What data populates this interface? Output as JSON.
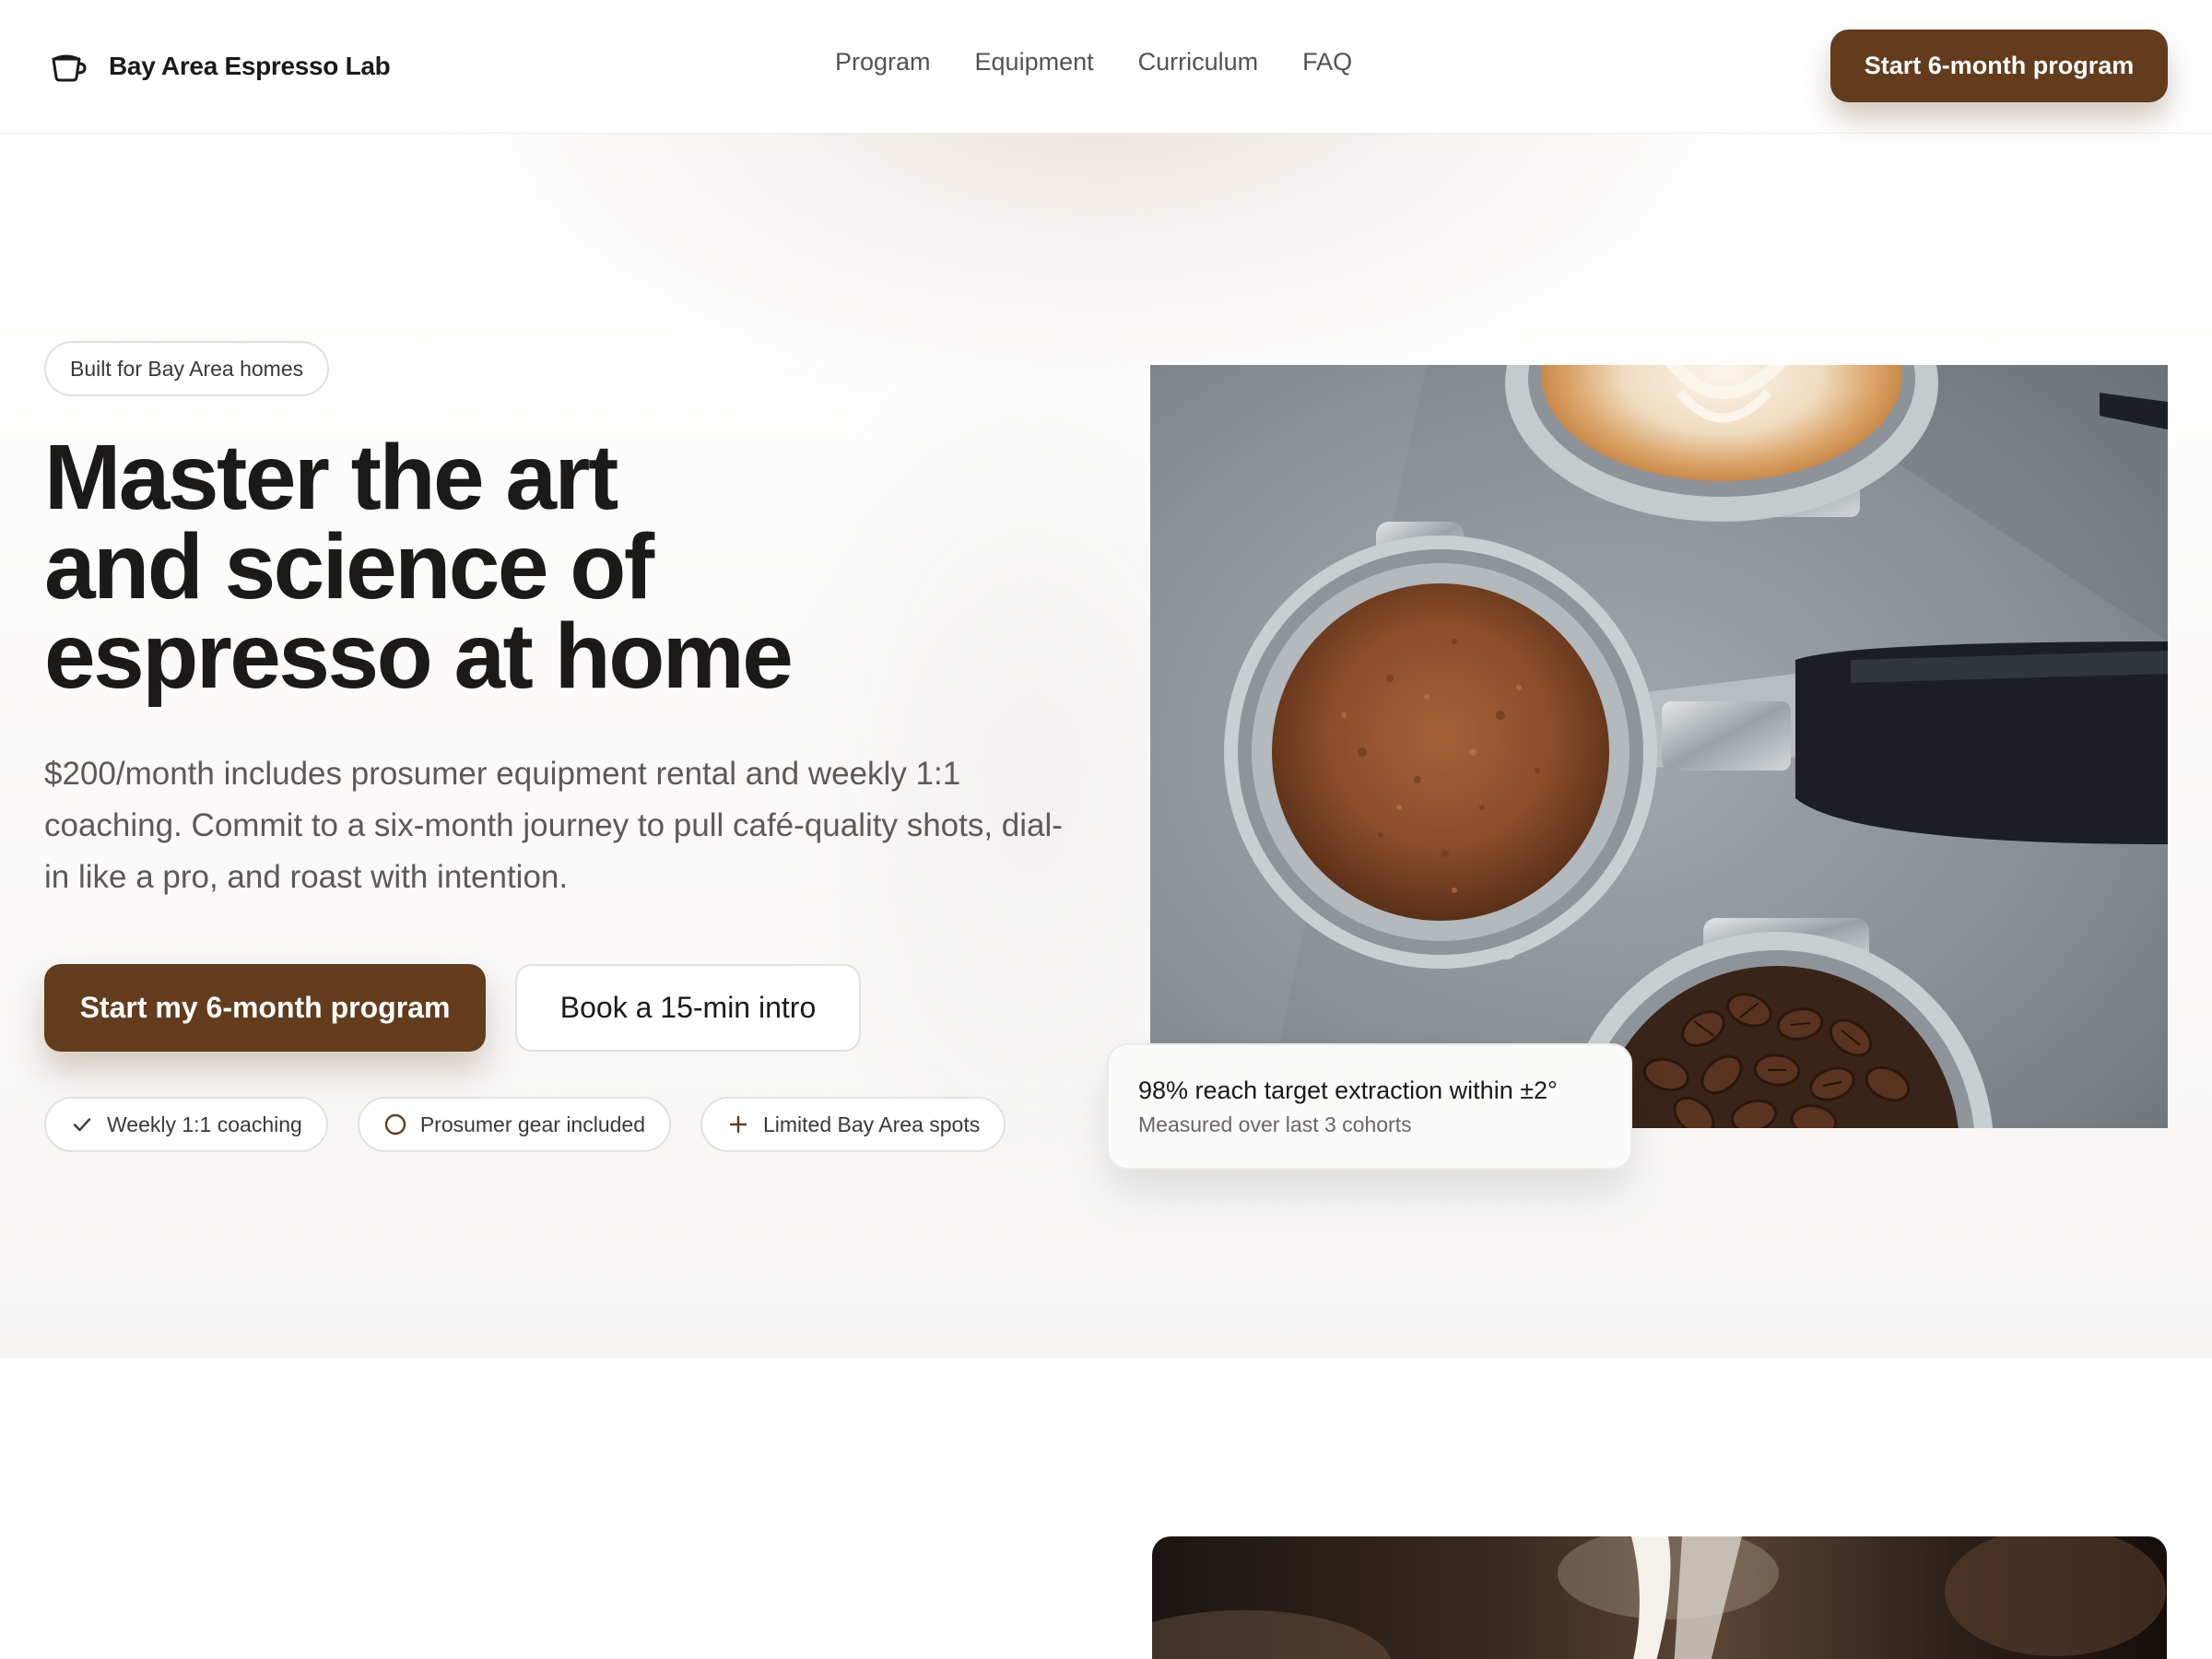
{
  "nav": {
    "brand_name": "Bay Area Espresso Lab",
    "links": [
      "Program",
      "Equipment",
      "Curriculum",
      "FAQ"
    ],
    "cta_label": "Start 6-month program"
  },
  "hero": {
    "badge": "Built for Bay Area homes",
    "headline_lines": [
      "Master the art",
      "and science of",
      "espresso at home"
    ],
    "subcopy": "$200/month includes prosumer equipment rental and weekly 1:1 coaching. Commit to a six-month journey to pull café-quality shots, dial-in like a pro, and roast with intention.",
    "primary_cta": "Start my 6-month program",
    "secondary_cta": "Book a 15-min intro",
    "chips": [
      {
        "icon": "check-icon",
        "label": "Weekly 1:1 coaching"
      },
      {
        "icon": "circle-icon",
        "label": "Prosumer gear included"
      },
      {
        "icon": "plus-icon",
        "label": "Limited Bay Area spots"
      }
    ],
    "stat": {
      "title": "98% reach target extraction within ±2°",
      "subtitle": "Measured over last 3 cohorts"
    }
  },
  "colors": {
    "accent": "#623c1d",
    "text": "#1b1a19",
    "muted": "#5c5956",
    "border": "#e3e1de"
  }
}
